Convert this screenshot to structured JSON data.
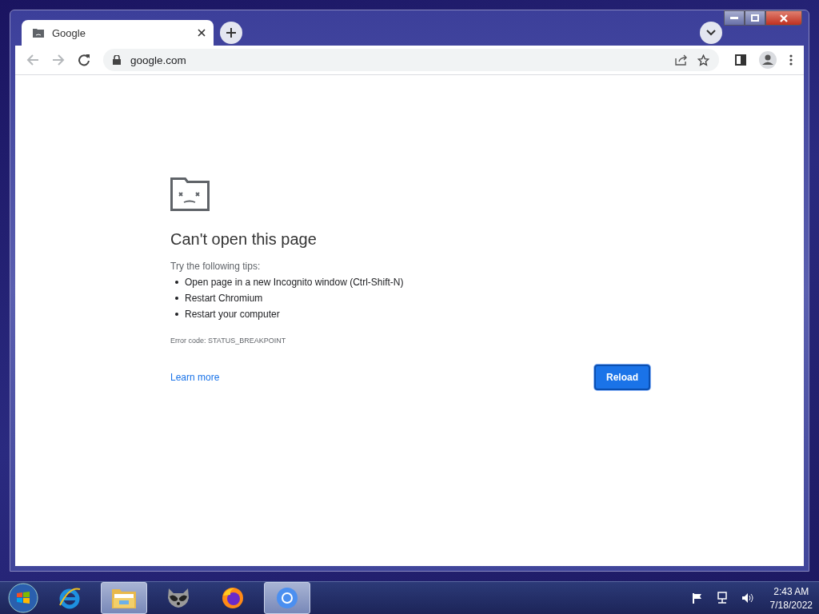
{
  "browser": {
    "tab": {
      "title": "Google",
      "selected": true
    },
    "address": "google.com"
  },
  "error": {
    "title": "Can't open this page",
    "tips_heading": "Try the following tips:",
    "tips": [
      "Open page in a new Incognito window (Ctrl-Shift-N)",
      "Restart Chromium",
      "Restart your computer"
    ],
    "error_code": "Error code: STATUS_BREAKPOINT",
    "learn_more": "Learn more",
    "reload": "Reload"
  },
  "taskbar": {
    "apps": [
      {
        "kind": "ie",
        "running": false
      },
      {
        "kind": "explorer",
        "running": true
      },
      {
        "kind": "raccoon",
        "running": false
      },
      {
        "kind": "firefox",
        "running": false
      },
      {
        "kind": "chromium",
        "running": true
      }
    ],
    "time": "2:43 AM",
    "date": "7/18/2022"
  }
}
